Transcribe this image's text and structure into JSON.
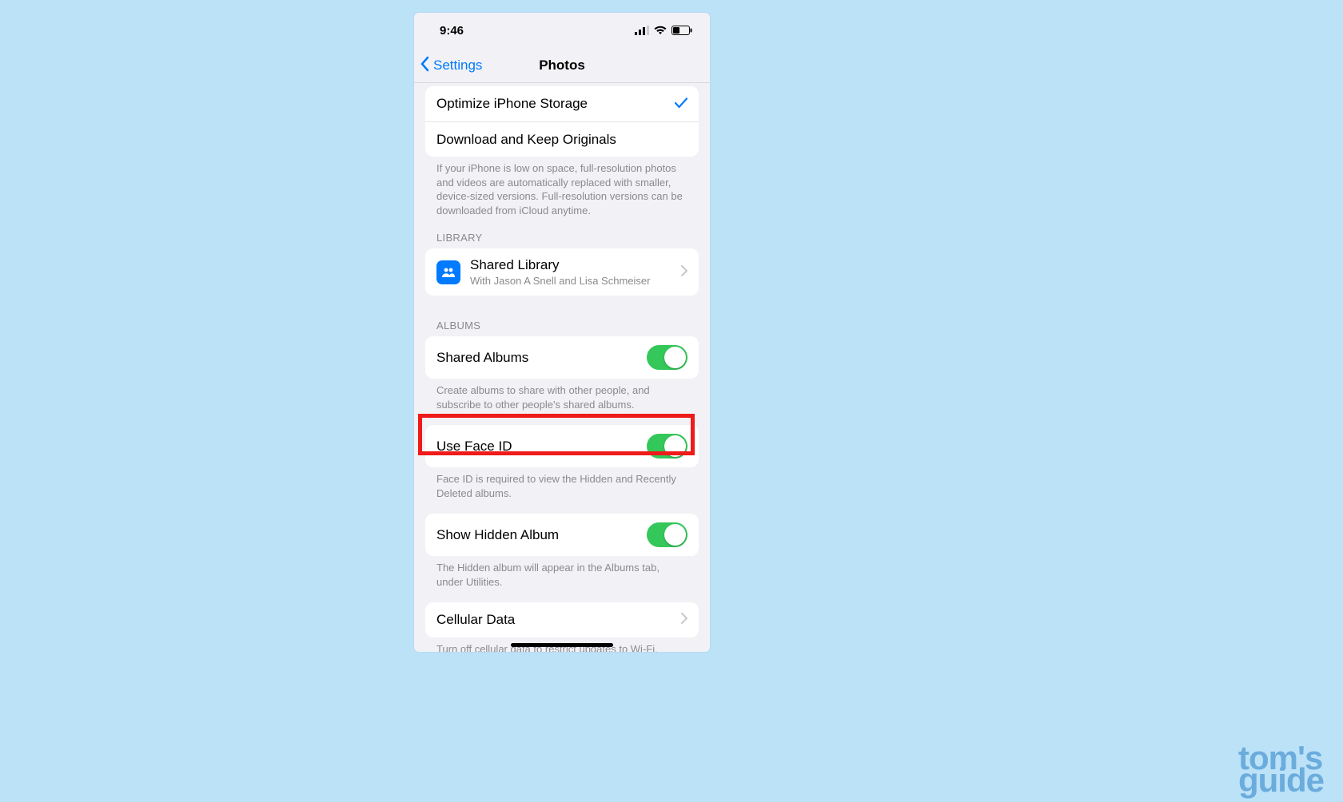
{
  "status": {
    "time": "9:46"
  },
  "nav": {
    "back": "Settings",
    "title": "Photos"
  },
  "storage": {
    "optimize": "Optimize iPhone Storage",
    "download": "Download and Keep Originals",
    "footer": "If your iPhone is low on space, full-resolution photos and videos are automatically replaced with smaller, device-sized versions. Full-resolution versions can be downloaded from iCloud anytime."
  },
  "library": {
    "header": "LIBRARY",
    "title": "Shared Library",
    "subtitle": "With Jason A Snell and Lisa Schmeiser"
  },
  "albums": {
    "header": "ALBUMS",
    "shared": "Shared Albums",
    "shared_footer": "Create albums to share with other people, and subscribe to other people's shared albums.",
    "faceid": "Use Face ID",
    "faceid_footer": "Face ID is required to view the Hidden and Recently Deleted albums.",
    "hidden": "Show Hidden Album",
    "hidden_footer": "The Hidden album will appear in the Albums tab, under Utilities.",
    "cellular": "Cellular Data",
    "cellular_footer": "Turn off cellular data to restrict updates to Wi-Fi, including Shared Albums and iCloud Photos."
  },
  "watermark": {
    "line1": "tom's",
    "line2": "guide"
  }
}
